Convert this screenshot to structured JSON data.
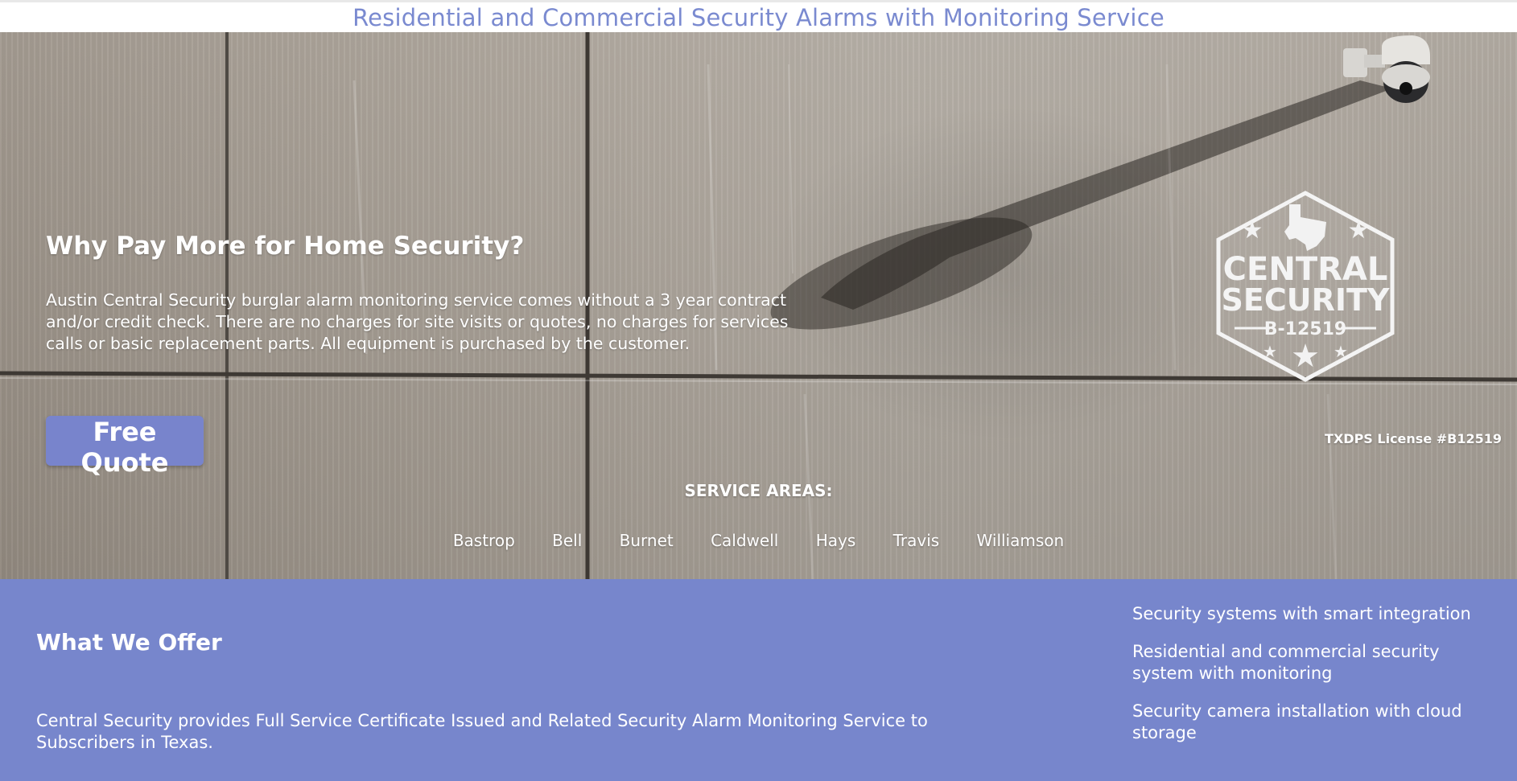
{
  "header": {
    "title": "Residential and Commercial Security Alarms with Monitoring Service"
  },
  "hero": {
    "heading": "Why Pay More for Home Security?",
    "description": "Austin Central Security burglar alarm monitoring service comes without a 3 year contract and/or credit check. There are no charges for site visits or quotes, no charges for services calls or basic replacement parts. All equipment is purchased by the customer.",
    "quote_button": "Free Quote",
    "license": "TXDPS License #B12519",
    "logo": {
      "line1": "CENTRAL",
      "line2": "SECURITY",
      "line3": "B-12519"
    },
    "service_areas_heading": "SERVICE AREAS:",
    "service_areas": [
      "Bastrop",
      "Bell",
      "Burnet",
      "Caldwell",
      "Hays",
      "Travis",
      "Williamson"
    ]
  },
  "offer": {
    "heading": "What We Offer",
    "text": "Central Security provides Full Service Certificate Issued and Related Security Alarm Monitoring Service to Subscribers in Texas.",
    "items": [
      "Security systems with smart integration",
      "Residential and commercial security system with monitoring",
      "Security camera installation with cloud storage"
    ]
  },
  "colors": {
    "accent": "#7786cc",
    "title": "#7a8ad0"
  }
}
